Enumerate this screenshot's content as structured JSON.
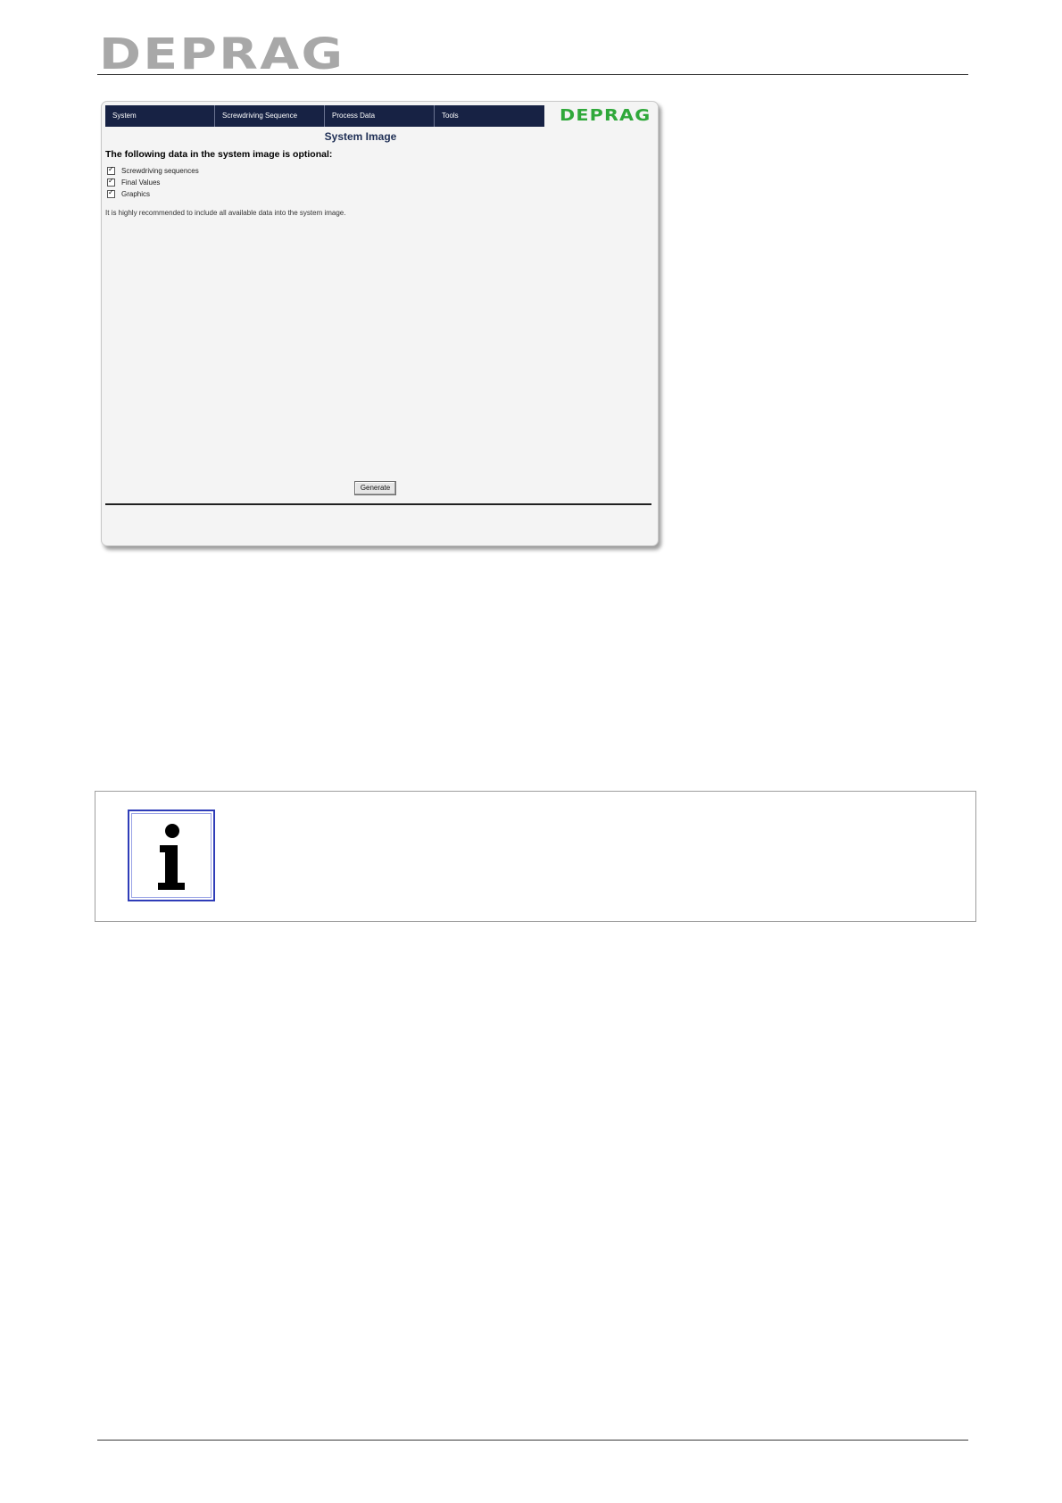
{
  "page": {
    "logo_text": "DEPRAG"
  },
  "app": {
    "menu": [
      {
        "label": "System"
      },
      {
        "label": "Screwdriving Sequence"
      },
      {
        "label": "Process Data"
      },
      {
        "label": "Tools"
      }
    ],
    "logo_text": "DEPRAG",
    "title": "System Image",
    "optional_heading": "The following data in the system image is optional:",
    "options": [
      {
        "label": "Screwdriving sequences",
        "checked": true
      },
      {
        "label": "Final Values",
        "checked": true
      },
      {
        "label": "Graphics",
        "checked": true
      }
    ],
    "recommendation": "It is highly recommended to include all available data into the system image.",
    "generate_label": "Generate"
  },
  "info_box": {
    "icon": "info-icon"
  },
  "colors": {
    "menu_bg": "#172244",
    "app_logo": "#2fa83a",
    "page_logo": "#a8a8a8",
    "info_icon_border": "#2f3db8"
  }
}
